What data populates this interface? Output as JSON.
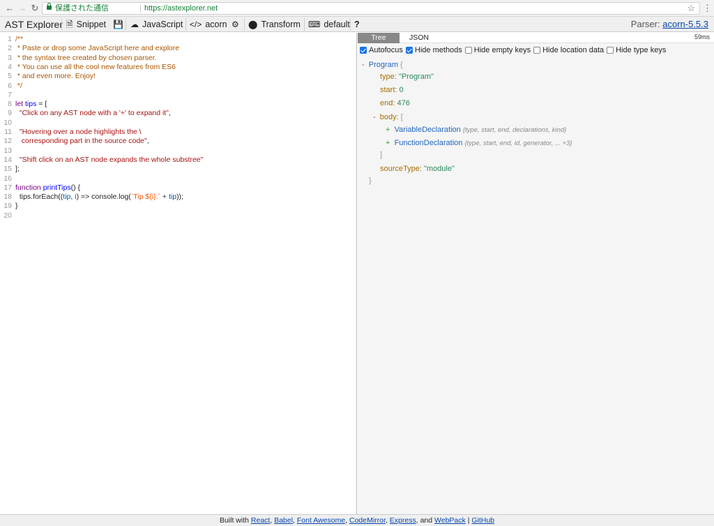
{
  "browser": {
    "secure_label": "保護された通信",
    "url": "https://astexplorer.net"
  },
  "toolbar": {
    "brand": "AST Explorer",
    "snippet": "Snippet",
    "language": "JavaScript",
    "parser_btn": "acorn",
    "transform": "Transform",
    "keymap": "default",
    "help": "?",
    "parser_label": "Parser:",
    "parser_version": "acorn-5.5.3"
  },
  "editor": {
    "lines": [
      {
        "n": "1",
        "html": "<span class=\"cm\">/**</span>"
      },
      {
        "n": "2",
        "html": "<span class=\"cm\"> * Paste or drop some JavaScript here and explore</span>"
      },
      {
        "n": "3",
        "html": "<span class=\"cm\"> * the syntax tree created by chosen parser.</span>"
      },
      {
        "n": "4",
        "html": "<span class=\"cm\"> * You can use all the cool new features from ES6</span>"
      },
      {
        "n": "5",
        "html": "<span class=\"cm\"> * and even more. Enjoy!</span>"
      },
      {
        "n": "6",
        "html": "<span class=\"cm\"> */</span>"
      },
      {
        "n": "7",
        "html": ""
      },
      {
        "n": "8",
        "html": "<span class=\"kw\">let</span> <span class=\"df\">tips</span> = ["
      },
      {
        "n": "9",
        "html": "  <span class=\"st\">\"Click on any AST node with a '+' to expand it\"</span>,"
      },
      {
        "n": "10",
        "html": ""
      },
      {
        "n": "11",
        "html": "  <span class=\"st\">\"Hovering over a node highlights the \\</span>"
      },
      {
        "n": "12",
        "html": "<span class=\"st\">   corresponding part in the source code\"</span>,"
      },
      {
        "n": "13",
        "html": ""
      },
      {
        "n": "14",
        "html": "  <span class=\"st\">\"Shift click on an AST node expands the whole substree\"</span>"
      },
      {
        "n": "15",
        "html": "];"
      },
      {
        "n": "16",
        "html": ""
      },
      {
        "n": "17",
        "html": "<span class=\"kw\">function</span> <span class=\"df\">printTips</span>() {"
      },
      {
        "n": "18",
        "html": "  tips.forEach((<span class=\"vr\">tip</span>, <span class=\"vr\">i</span>) => console.log(<span class=\"tp\">`Tip ${i}:`</span> + <span class=\"vr\">tip</span>));"
      },
      {
        "n": "19",
        "html": "}"
      },
      {
        "n": "20",
        "html": ""
      }
    ]
  },
  "panel": {
    "tabs": [
      "Tree",
      "JSON"
    ],
    "timing": "59ms",
    "options": [
      {
        "label": "Autofocus",
        "checked": true
      },
      {
        "label": "Hide methods",
        "checked": true
      },
      {
        "label": "Hide empty keys",
        "checked": false
      },
      {
        "label": "Hide location data",
        "checked": false
      },
      {
        "label": "Hide type keys",
        "checked": false
      }
    ],
    "tree": {
      "root_toggle": "-",
      "root_name": "Program",
      "open_brace": "{",
      "close_brace": "}",
      "type_key": "type:",
      "type_val": "\"Program\"",
      "start_key": "start:",
      "start_val": "0",
      "end_key": "end:",
      "end_val": "476",
      "body_toggle": "-",
      "body_key": "body:",
      "open_bracket": "[",
      "close_bracket": "]",
      "plus": "+",
      "n1_name": "VariableDeclaration",
      "n1_summary": "{type, start, end, declarations, kind}",
      "n2_name": "FunctionDeclaration",
      "n2_summary": "{type, start, end, id, generator, ... +3}",
      "src_key": "sourceType:",
      "src_val": "\"module\""
    }
  },
  "footer": {
    "built_with": "Built with",
    "links": [
      "React",
      "Babel",
      "Font Awesome",
      "CodeMirror",
      "Express",
      "WebPack",
      "GitHub"
    ],
    "and": "and",
    "pipe": "|"
  }
}
